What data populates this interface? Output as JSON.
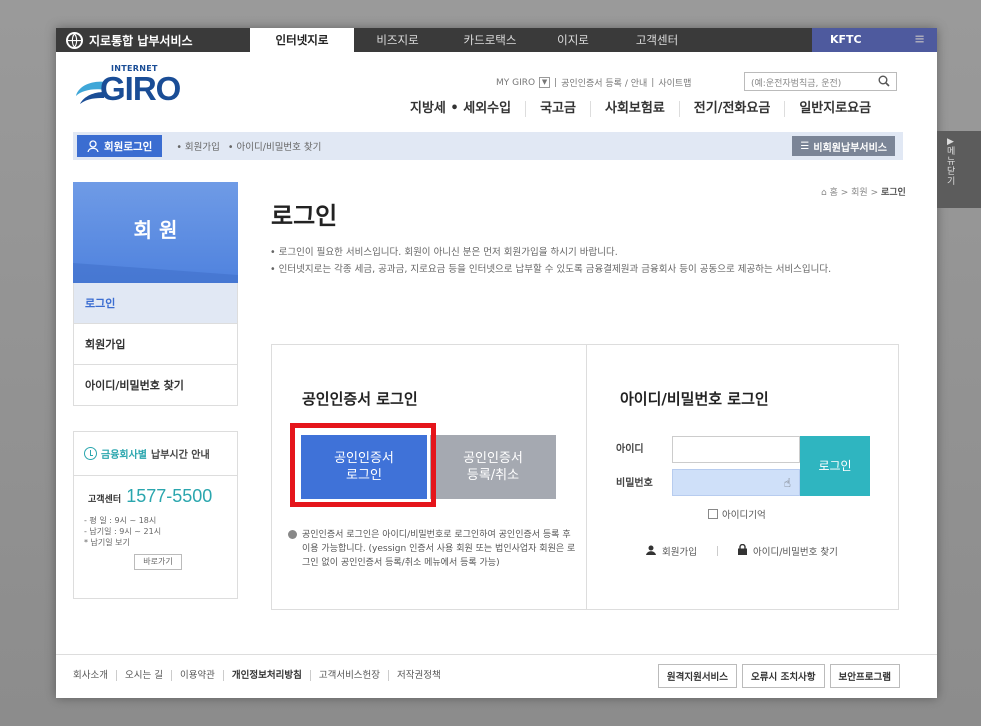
{
  "topbar": {
    "brand": "지로통합 납부서비스",
    "tabs": [
      "인터넷지로",
      "비즈지로",
      "카드로택스",
      "이지로",
      "고객센터"
    ],
    "kftc": "KFTC"
  },
  "header": {
    "logo_top": "INTERNET",
    "logo_main": "GIRO",
    "util_links": [
      "MY GIRO",
      "공인인증서 등록 / 안내",
      "사이트맵"
    ],
    "search_placeholder": "(예:운전자범칙금, 운전)",
    "main_nav": [
      "지방세 • 세외수입",
      "국고금",
      "사회보험료",
      "전기/전화요금",
      "일반지로요금"
    ]
  },
  "subbar": {
    "login_label": "회원로그인",
    "links": [
      "• 회원가입",
      "• 아이디/비밀번호 찾기"
    ],
    "nonmember": "비회원납부서비스"
  },
  "sidebar": {
    "title": "회 원",
    "items": [
      "로그인",
      "회원가입",
      "아이디/비밀번호 찾기"
    ],
    "pay_info_blue": "금융회사별",
    "pay_info_rest": "납부시간 안내",
    "cc_label": "고객센터",
    "cc_number": "1577-5500",
    "hours": [
      "- 평   일 : 9시 ~ 18시",
      "- 납기일 : 9시 ~ 21시",
      "  * 납기일 보기"
    ],
    "goto": "바로가기"
  },
  "breadcrumb": {
    "home": "홈",
    "level1": "회원",
    "current": "로그인"
  },
  "main": {
    "title": "로그인",
    "desc1": "• 로그인이 필요한 서비스입니다. 회원이 아니신 분은 먼저 회원가입을 하시기 바랍니다.",
    "desc2": "• 인터넷지로는 각종 세금, 공과금, 지로요금 등을 인터넷으로 납부할 수 있도록 금융결제원과 금융회사 등이 공동으로 제공하는 서비스입니다."
  },
  "cert": {
    "title": "공인인증서 로그인",
    "login_btn": [
      "공인인증서",
      "로그인"
    ],
    "reg_btn": [
      "공인인증서",
      "등록/취소"
    ],
    "note": "공인인증서 로그인은 아이디/비밀번호로 로그인하여 공인인증서 등록 후 이용 가능합니다. (yessign 인증서 사용 회원 또는 법인사업자 회원은 로그인 없이 공인인증서 등록/취소 메뉴에서 등록 가능)"
  },
  "idlogin": {
    "title": "아이디/비밀번호 로그인",
    "id_label": "아이디",
    "pw_label": "비밀번호",
    "login_btn": "로그인",
    "remember": "아이디기억",
    "signup": "회원가입",
    "find": "아이디/비밀번호 찾기"
  },
  "footer": {
    "links": [
      "회사소개",
      "오시는 길",
      "이용약관",
      "개인정보처리방침",
      "고객서비스헌장",
      "저작권정책"
    ],
    "buttons": [
      "원격지원서비스",
      "오류시 조치사항",
      "보안프로그램"
    ]
  },
  "sidetab": {
    "label": "메뉴닫기"
  }
}
